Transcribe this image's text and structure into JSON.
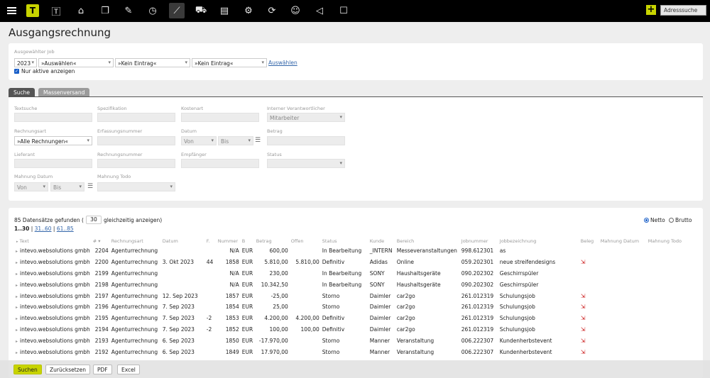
{
  "address_search": "Adresssuche",
  "page_title": "Ausgangsrechnung",
  "job": {
    "label": "Ausgewählter Job",
    "year": "2023",
    "select1": "»Auswählen«",
    "select2": "»Kein Eintrag«",
    "select3": "»Kein Eintrag«",
    "choose_link": "Auswählen",
    "only_active": "Nur aktive anzeigen"
  },
  "tabs": {
    "search": "Suche",
    "mass": "Massenversand"
  },
  "filters": {
    "textsuche": "Textsuche",
    "spezifikation": "Spezifikation",
    "kostenart": "Kostenart",
    "intern_verantw": "Interner Verantwortlicher",
    "intern_verantw_value": "Mitarbeiter",
    "rechnungsart": "Rechnungsart",
    "rechnungsart_value": "»Alle Rechnungen«",
    "erfassungsnummer": "Erfassungsnummer",
    "datum": "Datum",
    "von": "Von",
    "bis": "Bis",
    "betrag": "Betrag",
    "lieferant": "Lieferant",
    "rechnungsnummer": "Rechnungsnummer",
    "empfaenger": "Empfänger",
    "status": "Status",
    "mahnung_datum": "Mahnung Datum",
    "mahnung_todo": "Mahnung Todo"
  },
  "results": {
    "count_prefix": "85 Datensätze gefunden (",
    "per_page": "30",
    "count_suffix": "gleichzeitig anzeigen)",
    "page_current": "1..30",
    "page2": "31..60",
    "page3": "61..85",
    "netto": "Netto",
    "brutto": "Brutto"
  },
  "columns": [
    "Text",
    "#",
    "Rechnungsart",
    "Datum",
    "F.",
    "Nummer",
    "B",
    "Betrag",
    "Offen",
    "Status",
    "Kunde",
    "Bereich",
    "Jobnummer",
    "Jobbezeichnung",
    "Beleg",
    "Mahnung Datum",
    "Mahnung Todo"
  ],
  "rows": [
    {
      "text": "intevo.websolutions gmbh",
      "id": "2204",
      "art": "Agenturrechnung",
      "datum": "",
      "f": "",
      "nummer": "N/A",
      "b": "EUR",
      "betrag": "600,00",
      "offen": "",
      "status": "In Bearbeitung",
      "kunde": "_INTERN",
      "bereich": "Messeveranstaltungen",
      "jobnr": "998.612301",
      "jobbez": "as",
      "beleg": false
    },
    {
      "text": "intevo.websolutions gmbh",
      "id": "2200",
      "art": "Agenturrechnung",
      "datum": "3. Okt 2023",
      "f": "44",
      "nummer": "1858",
      "b": "EUR",
      "betrag": "5.810,00",
      "offen": "5.810,00",
      "status": "Definitiv",
      "kunde": "Adidas",
      "bereich": "Online",
      "jobnr": "059.202301",
      "jobbez": "neue streifendesigns",
      "beleg": true
    },
    {
      "text": "intevo.websolutions gmbh",
      "id": "2199",
      "art": "Agenturrechnung",
      "datum": "",
      "f": "",
      "nummer": "N/A",
      "b": "EUR",
      "betrag": "230,00",
      "offen": "",
      "status": "In Bearbeitung",
      "kunde": "SONY",
      "bereich": "Haushaltsgeräte",
      "jobnr": "090.202302",
      "jobbez": "Geschirrspüler",
      "beleg": false
    },
    {
      "text": "intevo.websolutions gmbh",
      "id": "2198",
      "art": "Agenturrechnung",
      "datum": "",
      "f": "",
      "nummer": "N/A",
      "b": "EUR",
      "betrag": "10.342,50",
      "offen": "",
      "status": "In Bearbeitung",
      "kunde": "SONY",
      "bereich": "Haushaltsgeräte",
      "jobnr": "090.202302",
      "jobbez": "Geschirrspüler",
      "beleg": false
    },
    {
      "text": "intevo.websolutions gmbh",
      "id": "2197",
      "art": "Agenturrechnung",
      "datum": "12. Sep 2023",
      "f": "",
      "nummer": "1857",
      "b": "EUR",
      "betrag": "-25,00",
      "offen": "",
      "status": "Storno",
      "kunde": "Daimler",
      "bereich": "car2go",
      "jobnr": "261.012319",
      "jobbez": "Schulungsjob",
      "beleg": true
    },
    {
      "text": "intevo.websolutions gmbh",
      "id": "2196",
      "art": "Agenturrechnung",
      "datum": "7. Sep 2023",
      "f": "",
      "nummer": "1854",
      "b": "EUR",
      "betrag": "25,00",
      "offen": "",
      "status": "Storno",
      "kunde": "Daimler",
      "bereich": "car2go",
      "jobnr": "261.012319",
      "jobbez": "Schulungsjob",
      "beleg": true
    },
    {
      "text": "intevo.websolutions gmbh",
      "id": "2195",
      "art": "Agenturrechnung",
      "datum": "7. Sep 2023",
      "f": "-2",
      "nummer": "1853",
      "b": "EUR",
      "betrag": "4.200,00",
      "offen": "4.200,00",
      "status": "Definitiv",
      "kunde": "Daimler",
      "bereich": "car2go",
      "jobnr": "261.012319",
      "jobbez": "Schulungsjob",
      "beleg": true
    },
    {
      "text": "intevo.websolutions gmbh",
      "id": "2194",
      "art": "Agenturrechnung",
      "datum": "7. Sep 2023",
      "f": "-2",
      "nummer": "1852",
      "b": "EUR",
      "betrag": "100,00",
      "offen": "100,00",
      "status": "Definitiv",
      "kunde": "Daimler",
      "bereich": "car2go",
      "jobnr": "261.012319",
      "jobbez": "Schulungsjob",
      "beleg": true
    },
    {
      "text": "intevo.websolutions gmbh",
      "id": "2193",
      "art": "Agenturrechnung",
      "datum": "6. Sep 2023",
      "f": "",
      "nummer": "1850",
      "b": "EUR",
      "betrag": "-17.970,00",
      "offen": "",
      "status": "Storno",
      "kunde": "Manner",
      "bereich": "Veranstaltung",
      "jobnr": "006.222307",
      "jobbez": "Kundenherbstevent",
      "beleg": true
    },
    {
      "text": "intevo.websolutions gmbh",
      "id": "2192",
      "art": "Agenturrechnung",
      "datum": "6. Sep 2023",
      "f": "",
      "nummer": "1849",
      "b": "EUR",
      "betrag": "17.970,00",
      "offen": "",
      "status": "Storno",
      "kunde": "Manner",
      "bereich": "Veranstaltung",
      "jobnr": "006.222307",
      "jobbez": "Kundenherbstevent",
      "beleg": true
    }
  ],
  "buttons": {
    "search": "Suchen",
    "reset": "Zurücksetzen",
    "pdf": "PDF",
    "excel": "Excel"
  },
  "colors": {
    "accent": "#c8d400",
    "link": "#3366aa",
    "nav_bg": "#000000"
  }
}
